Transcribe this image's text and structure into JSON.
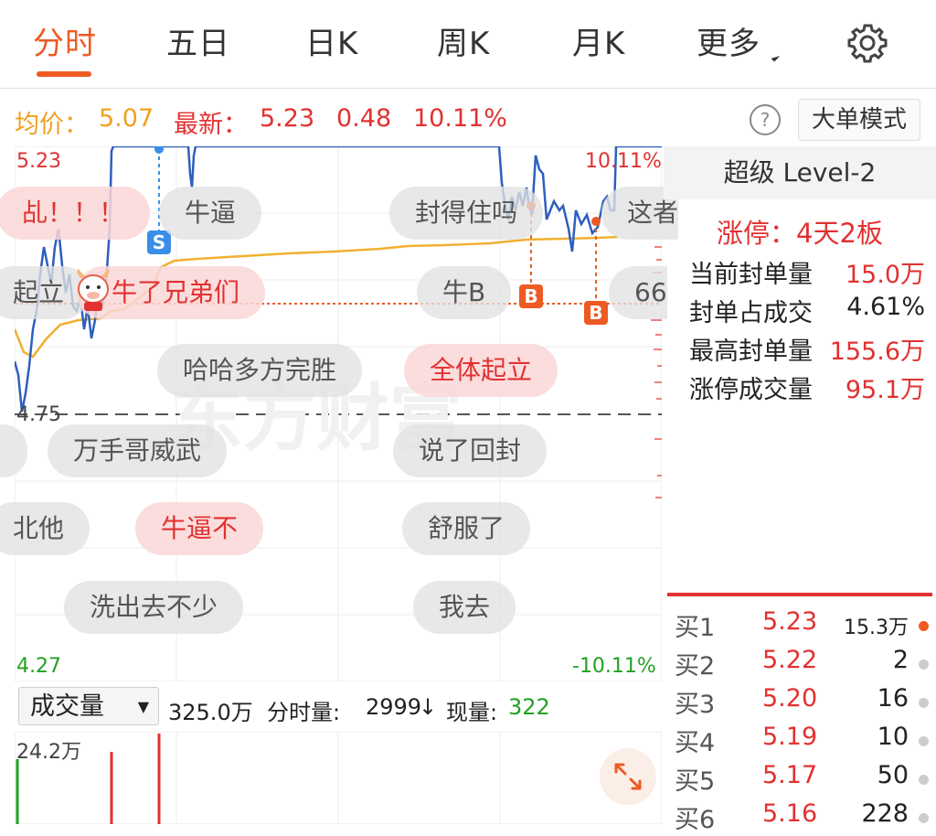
{
  "tabs": {
    "items": [
      {
        "label": "分时",
        "active": true
      },
      {
        "label": "五日",
        "active": false
      },
      {
        "label": "日K",
        "active": false
      },
      {
        "label": "周K",
        "active": false
      },
      {
        "label": "月K",
        "active": false
      },
      {
        "label": "更多",
        "active": false
      }
    ],
    "settings_icon": "gear-icon"
  },
  "infobar": {
    "avg_label": "均价：",
    "avg_value": "5.07",
    "latest_label": "最新：",
    "latest_value": "5.23",
    "change": "0.48",
    "change_pct": "10.11%",
    "help_symbol": "?",
    "big_order_mode": "大单模式"
  },
  "chart": {
    "price_high": "5.23",
    "price_mid": "4.75",
    "price_low": "4.27",
    "pct_high": "10.11%",
    "pct_low": "-10.11%",
    "watermark": "东方财富",
    "markers": {
      "sell": "S",
      "buy": "B"
    },
    "colors": {
      "price_line": "#2d5fbf",
      "avg_line": "#f0b030",
      "up": "#e23131",
      "down": "#22a022"
    }
  },
  "danmaku": [
    "乩！！！",
    "牛逼",
    "封得住吗",
    "这者",
    "起立",
    "牛了兄弟们",
    "牛B",
    "66",
    "哈哈多方完胜",
    "全体起立",
    "万手哥威武",
    "说了回封",
    "北他",
    "牛逼不",
    "舒服了",
    "洗出去不少",
    "我去"
  ],
  "side": {
    "title": "超级 Level-2",
    "limit_label": "涨停：",
    "limit_value": "4天2板",
    "stats": [
      {
        "label": "当前封单量",
        "value": "15.0万"
      },
      {
        "label": "封单占成交",
        "value": "4.61%"
      },
      {
        "label": "最高封单量",
        "value": "155.6万"
      },
      {
        "label": "涨停成交量",
        "value": "95.1万"
      }
    ],
    "book": [
      {
        "label": "买1",
        "price": "5.23",
        "vol": "15.3万",
        "highlight": true
      },
      {
        "label": "买2",
        "price": "5.22",
        "vol": "2",
        "highlight": false
      },
      {
        "label": "买3",
        "price": "5.20",
        "vol": "16",
        "highlight": false
      },
      {
        "label": "买4",
        "price": "5.19",
        "vol": "10",
        "highlight": false
      },
      {
        "label": "买5",
        "price": "5.17",
        "vol": "50",
        "highlight": false
      },
      {
        "label": "买6",
        "price": "5.16",
        "vol": "228",
        "highlight": false
      }
    ]
  },
  "volume": {
    "selector": "成交量",
    "selector_arrow": "▼",
    "total": "325.0万",
    "minute_label": "分时量:",
    "minute_value": "2999",
    "arrow": "↓",
    "now_label": "现量:",
    "now_value": "322",
    "axis_max": "24.2万"
  }
}
